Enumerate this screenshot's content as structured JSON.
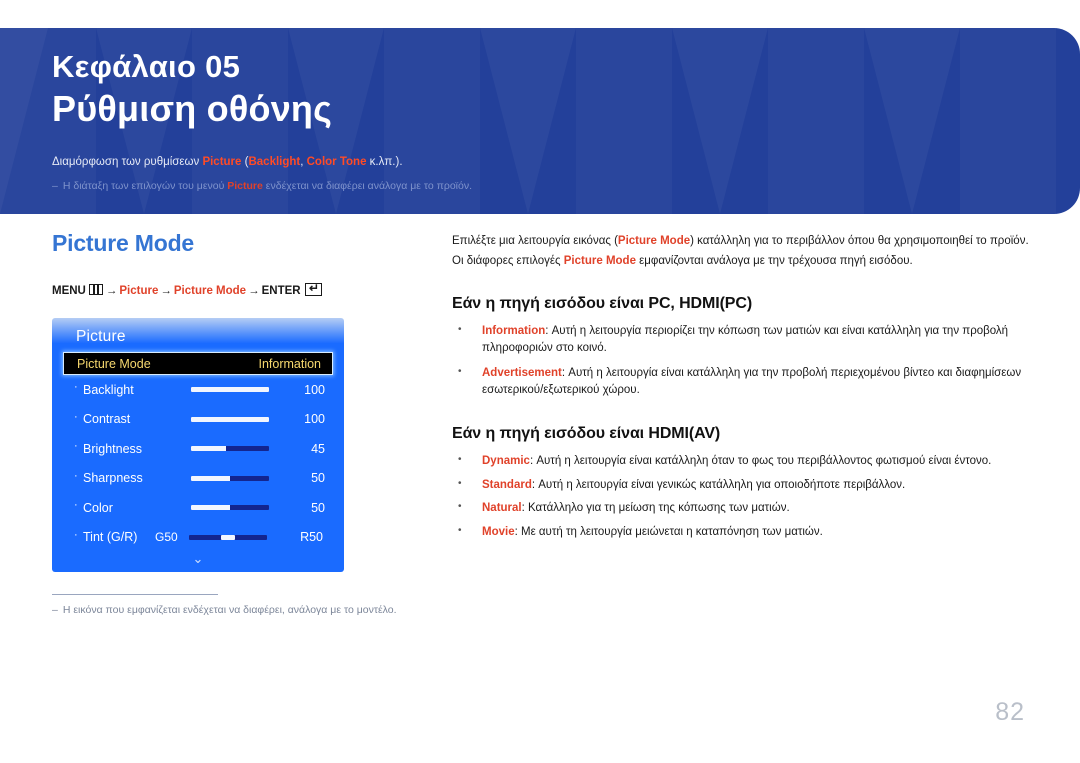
{
  "header": {
    "chapter_label": "Κεφάλαιο 05",
    "chapter_title": "Ρύθμιση οθόνης",
    "subtitle_pre": "Διαμόρφωση των ρυθμίσεων ",
    "subtitle_kw1": "Picture",
    "subtitle_mid1": " (",
    "subtitle_kw2": "Backlight",
    "subtitle_mid2": ", ",
    "subtitle_kw3": "Color Tone",
    "subtitle_post": " κ.λπ.).",
    "note_dash": "‒",
    "note_pre": "Η διάταξη των επιλογών του μενού ",
    "note_kw": "Picture",
    "note_post": " ενδέχεται να διαφέρει ανάλογα με το προϊόν.",
    "accent_banner": "#23409a",
    "accent_keyword": "#e0422a"
  },
  "left": {
    "section_heading": "Picture Mode",
    "section_heading_color": "#3575d3",
    "menu_path": {
      "menu_label": "MENU",
      "menu_icon": "menu-grid-icon",
      "arrow": "→",
      "step1": "Picture",
      "step2": "Picture Mode",
      "enter_label": "ENTER",
      "enter_icon": "enter-key-icon",
      "enter_glyph": "↵"
    },
    "osd": {
      "title": "Picture",
      "highlight_row": {
        "label": "Picture Mode",
        "value": "Information",
        "text_color": "#f5d76e",
        "background": "#000000"
      },
      "rows": [
        {
          "bullet": "·",
          "label": "Backlight",
          "value": "100",
          "fill_percent": 100,
          "type": "bar"
        },
        {
          "bullet": "·",
          "label": "Contrast",
          "value": "100",
          "fill_percent": 100,
          "type": "bar"
        },
        {
          "bullet": "·",
          "label": "Brightness",
          "value": "45",
          "fill_percent": 45,
          "type": "bar"
        },
        {
          "bullet": "·",
          "label": "Sharpness",
          "value": "50",
          "fill_percent": 50,
          "type": "bar"
        },
        {
          "bullet": "·",
          "label": "Color",
          "value": "50",
          "fill_percent": 50,
          "type": "bar"
        },
        {
          "bullet": "·",
          "label": "Tint (G/R)",
          "left_label": "G50",
          "right_label": "R50",
          "type": "centered"
        }
      ],
      "scroll_chevron": "chevron-down-icon",
      "scroll_chevron_glyph": "⌄",
      "panel_color": "#1a6bff",
      "track_color": "#13258f"
    },
    "footnote": {
      "dash": "‒",
      "text": "Η εικόνα που εμφανίζεται ενδέχεται να διαφέρει, ανάλογα με το μοντέλο."
    }
  },
  "right": {
    "intro": {
      "line1_pre": "Επιλέξτε μια λειτουργία εικόνας (",
      "line1_kw": "Picture Mode",
      "line1_post": ") κατάλληλη για το περιβάλλον όπου θα χρησιμοποιηθεί το προϊόν.",
      "line2_pre": "Οι διάφορες επιλογές ",
      "line2_kw": "Picture Mode",
      "line2_post": " εμφανίζονται ανάλογα με την τρέχουσα πηγή εισόδου."
    },
    "section_pc": {
      "heading": "Εάν η πηγή εισόδου είναι PC, HDMI(PC)",
      "items": [
        {
          "kw": "Information",
          "text": ": Αυτή η λειτουργία περιορίζει την κόπωση των ματιών και είναι κατάλληλη για την προβολή πληροφοριών στο κοινό."
        },
        {
          "kw": "Advertisement",
          "text": ": Αυτή η λειτουργία είναι κατάλληλη για την προβολή περιεχομένου βίντεο και διαφημίσεων εσωτερικού/εξωτερικού χώρου."
        }
      ]
    },
    "section_av": {
      "heading": "Εάν η πηγή εισόδου είναι HDMI(AV)",
      "items": [
        {
          "kw": "Dynamic",
          "text": ": Αυτή η λειτουργία είναι κατάλληλη όταν το φως του περιβάλλοντος φωτισμού είναι έντονο."
        },
        {
          "kw": "Standard",
          "text": ": Αυτή η λειτουργία είναι γενικώς κατάλληλη για οποιοδήποτε περιβάλλον."
        },
        {
          "kw": "Natural",
          "text": ": Κατάλληλο για τη μείωση της κόπωσης των ματιών."
        },
        {
          "kw": "Movie",
          "text": ": Με αυτή τη λειτουργία μειώνεται η καταπόνηση των ματιών."
        }
      ]
    }
  },
  "footer": {
    "page_number": "82"
  }
}
